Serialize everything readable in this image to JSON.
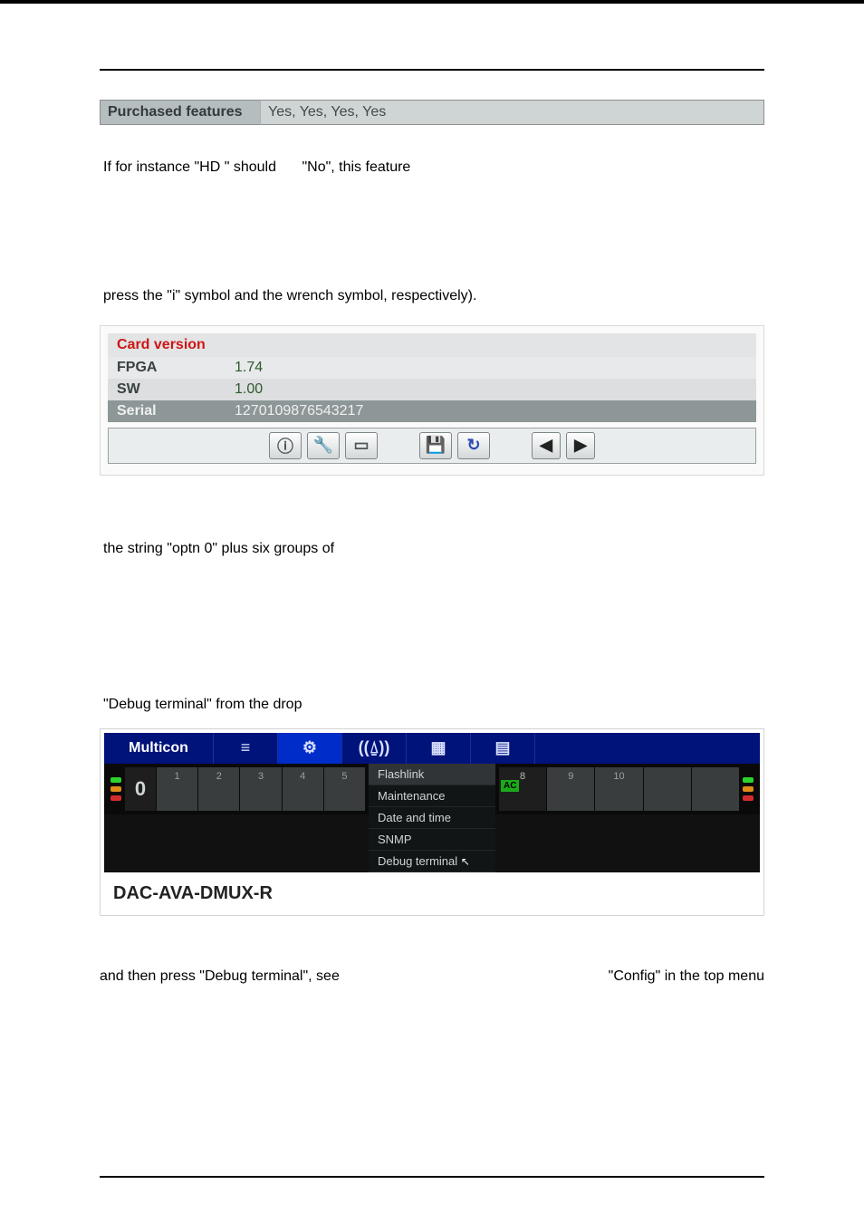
{
  "purchased_features": {
    "label": "Purchased features",
    "value": "Yes, Yes, Yes, Yes"
  },
  "text": {
    "hd_line_a": "If for instance \"HD \" should",
    "hd_line_b": "\"No\", this feature",
    "press_i": "press the \"i\" symbol and the wrench symbol, respectively).",
    "optn": "the string \"optn 0\" plus six groups of",
    "debug_drop": "\"Debug terminal\" from the drop",
    "press_debug": "and then press \"Debug terminal\", see",
    "config_menu": "\"Config\" in the top menu"
  },
  "card_version": {
    "header": "Card version",
    "fpga_key": "FPGA",
    "fpga_val": "1.74",
    "sw_key": "SW",
    "sw_val": "1.00",
    "serial_key": "Serial",
    "serial_val": "1270109876543217"
  },
  "iconbar": {
    "info": "ⓘ",
    "wrench": "🔧",
    "display": "▭",
    "save": "💾",
    "reload": "↻",
    "left": "◀",
    "right": "▶"
  },
  "multicon": {
    "title": "Multicon",
    "icons": {
      "hamburger": "≡",
      "config": "⚙",
      "antenna": "((⍙))",
      "grid": "▦",
      "doc": "▤"
    },
    "menu": {
      "flashlink": "Flashlink",
      "maintenance": "Maintenance",
      "datetime": "Date and time",
      "snmp": "SNMP",
      "debug": "Debug terminal",
      "cursor": "↖"
    },
    "rack_left": {
      "big0": "0",
      "slots": [
        "1",
        "2",
        "3",
        "4",
        "5"
      ]
    },
    "rack_right": {
      "slots": [
        "8",
        "9",
        "10"
      ],
      "ac": "AC"
    },
    "device_label": "DAC-AVA-DMUX-R"
  }
}
